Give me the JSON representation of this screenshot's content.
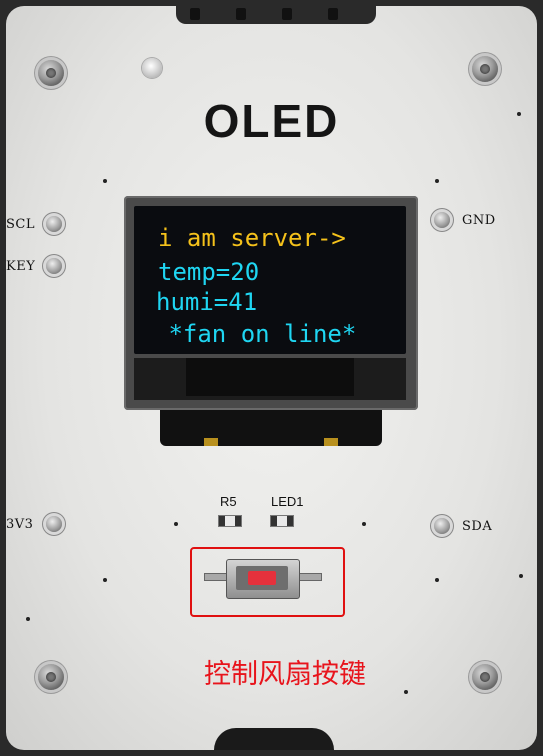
{
  "module_title": "OLED",
  "pin_labels": {
    "scl": "SCL",
    "key": "KEY",
    "gnd": "GND",
    "v3v3": "3V3",
    "sda": "SDA"
  },
  "oled_display": {
    "line1": "i am server->",
    "line2": "temp=20",
    "line3": "humi=41",
    "line4": " *fan on line*"
  },
  "component_labels": {
    "r5": "R5",
    "led1": "LED1"
  },
  "annotation": "控制风扇按键",
  "colors": {
    "oled_yellow": "#f5c21b",
    "oled_cyan": "#1fd6f2",
    "annotation_red": "#e8141c"
  }
}
